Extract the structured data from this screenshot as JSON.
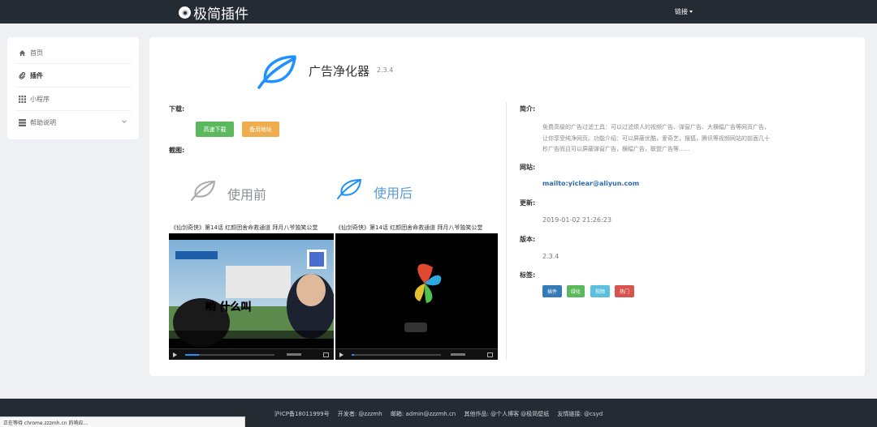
{
  "header": {
    "brand": "极简插件",
    "nav_link": "链接"
  },
  "sidebar": {
    "items": [
      {
        "label": "首页",
        "icon": "home-icon"
      },
      {
        "label": "插件",
        "icon": "paperclip-icon"
      },
      {
        "label": "小程序",
        "icon": "grid-icon"
      },
      {
        "label": "帮助说明",
        "icon": "list-icon"
      }
    ]
  },
  "app": {
    "name": "广告净化器",
    "version": "2.3.4"
  },
  "download": {
    "label": "下载:",
    "btn_download": "高速下载",
    "btn_mirror": "备用地址"
  },
  "screenshots": {
    "label": "截图:",
    "before": "使用前",
    "after": "使用后",
    "video_title": "《仙剑奇侠》第14话 红颜团舍命救通道 拜月八爷独笑公堂"
  },
  "info": {
    "intro_label": "简介:",
    "intro_text": "免费高级的广告过滤工具：可以过滤烦人的视频广告、弹窗广告、大横幅广告等网页广告，让你享受纯净网页。功能介绍：可以屏蔽优酷，爱奇艺，搜狐，腾讯等视频网站的前面几十秒广告而且可以屏蔽弹窗广告，横幅广告，联盟广告等......",
    "site_label": "网站:",
    "site": "mailto:yiclear@aliyun.com",
    "updated_label": "更新:",
    "updated": "2019-01-02 21:26:23",
    "version_label": "版本:",
    "version": "2.3.4",
    "tags_label": "标签:",
    "tags": [
      {
        "label": "插件",
        "color": "#337ab7"
      },
      {
        "label": "绿化",
        "color": "#5cb85c"
      },
      {
        "label": "视频",
        "color": "#5bc0de"
      },
      {
        "label": "热门",
        "color": "#d9534f"
      }
    ]
  },
  "footer": {
    "icp": "沪ICP备18011999号",
    "developer": "开发者: @zzzmh",
    "email": "邮箱: admin@zzzmh.cn",
    "others": "其他作品: @个人博客 @极简壁纸",
    "friends": "友情链接: @csyd"
  },
  "status_bar": "正在等待 chrome.zzzmh.cn 的响应...",
  "colors": {
    "navbar": "#252b33",
    "accent": "#337ab7",
    "leaf": "#1e90ff"
  }
}
